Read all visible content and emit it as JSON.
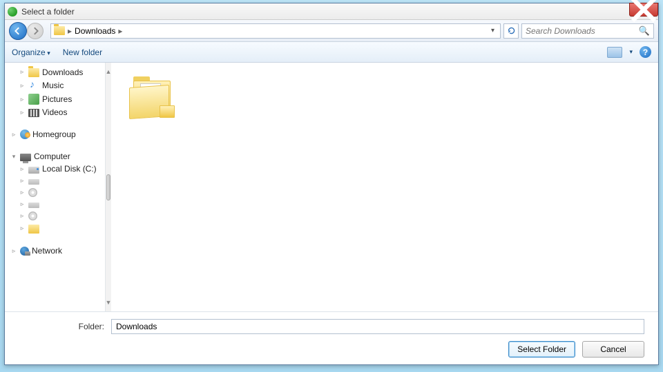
{
  "window": {
    "title": "Select a folder"
  },
  "nav": {
    "breadcrumb_current": "Downloads",
    "search_placeholder": "Search Downloads"
  },
  "toolbar": {
    "organize": "Organize",
    "new_folder": "New folder"
  },
  "sidebar": {
    "downloads": "Downloads",
    "music": "Music",
    "pictures": "Pictures",
    "videos": "Videos",
    "homegroup": "Homegroup",
    "computer": "Computer",
    "local_disk": "Local Disk (C:)",
    "network": "Network"
  },
  "footer": {
    "folder_label": "Folder:",
    "folder_value": "Downloads",
    "select": "Select Folder",
    "cancel": "Cancel"
  }
}
